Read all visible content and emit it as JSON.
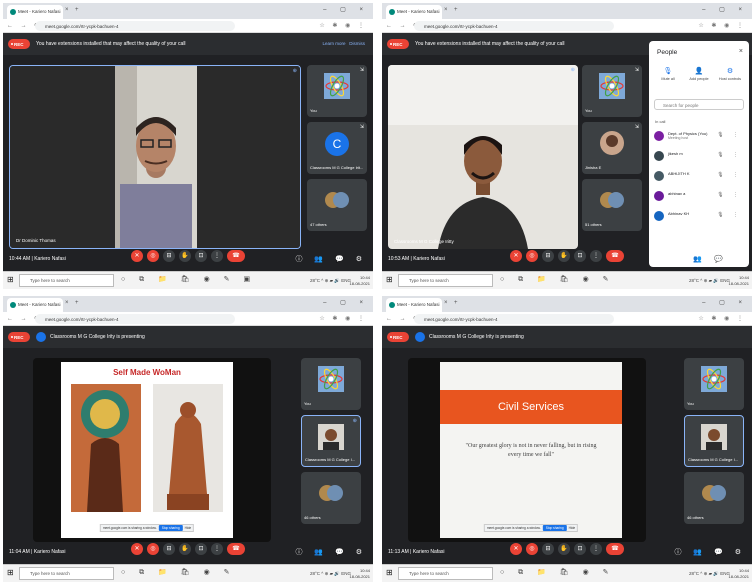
{
  "browser": {
    "tab_title": "Meet - Kariero Nafasi",
    "tab_title_alt": "Meet - Kariero Nafasi",
    "url": "meet.google.com/rtr-ycpk-bachuen-4"
  },
  "banner": {
    "warning": "You have extensions installed that may affect the quality of your call",
    "learn_more": "Learn more",
    "dismiss": "Dismiss",
    "rec_label": "REC",
    "presenting": "Classrooms M G College Irity is presenting"
  },
  "panels": [
    {
      "main_name": "Dr Dominic Thomas",
      "tiles": [
        {
          "label": "You"
        },
        {
          "label": "Classrooms M G College Irit..."
        },
        {
          "label": "47 others"
        }
      ],
      "time": "10:44 AM",
      "meeting": "Kariero Nafasi"
    },
    {
      "main_name": "Classrooms M G College Iritty",
      "tiles": [
        {
          "label": "You"
        },
        {
          "label": "Jinisha E"
        },
        {
          "label": "51 others"
        }
      ],
      "time": "10:53 AM",
      "meeting": "Kariero Nafasi"
    },
    {
      "slide_title": "Self Made WoMan",
      "tiles": [
        {
          "label": "You"
        },
        {
          "label": "Classrooms M G College I..."
        },
        {
          "label": "46 others"
        }
      ],
      "time": "11:04 AM",
      "meeting": "Kariero Nafasi"
    },
    {
      "slide_title": "Civil Services",
      "slide_quote": "\"Our greatest glory is not in never falling, but in rising every time we fall\"",
      "tiles": [
        {
          "label": "You"
        },
        {
          "label": "Classrooms M G College I..."
        },
        {
          "label": "46 others"
        }
      ],
      "time": "11:13 AM",
      "meeting": "Kariero Nafasi"
    }
  ],
  "screenshare_bar": {
    "text": "meet.google.com is sharing a window.",
    "stop": "Stop sharing",
    "hide": "Hide"
  },
  "people_panel": {
    "title": "People",
    "actions": [
      "Mute all",
      "Add people",
      "Host controls"
    ],
    "search_placeholder": "Search for people",
    "section": "In call",
    "rows": [
      {
        "name": "Dept. of Physics (You)",
        "sub": "Meeting host",
        "color": "#7b1fa2"
      },
      {
        "name": "jikesh m",
        "sub": "",
        "color": "#37474f"
      },
      {
        "name": "ABHIJITH K",
        "sub": "",
        "color": "#455a64"
      },
      {
        "name": "abhinav a",
        "sub": "",
        "color": "#6a1b9a"
      },
      {
        "name": "Abhinav KH",
        "sub": "",
        "color": "#1565c0"
      }
    ]
  },
  "taskbar": {
    "search_placeholder": "Type here to search",
    "temp": "28°C",
    "lang": "ENG",
    "clock_lines": [
      "10:44",
      "18-08-2021"
    ]
  },
  "icons": {
    "people": "people-icon",
    "chat": "chat-icon",
    "mic": "mic-off-icon",
    "cam": "camera-off-icon",
    "end": "end-call-icon"
  }
}
